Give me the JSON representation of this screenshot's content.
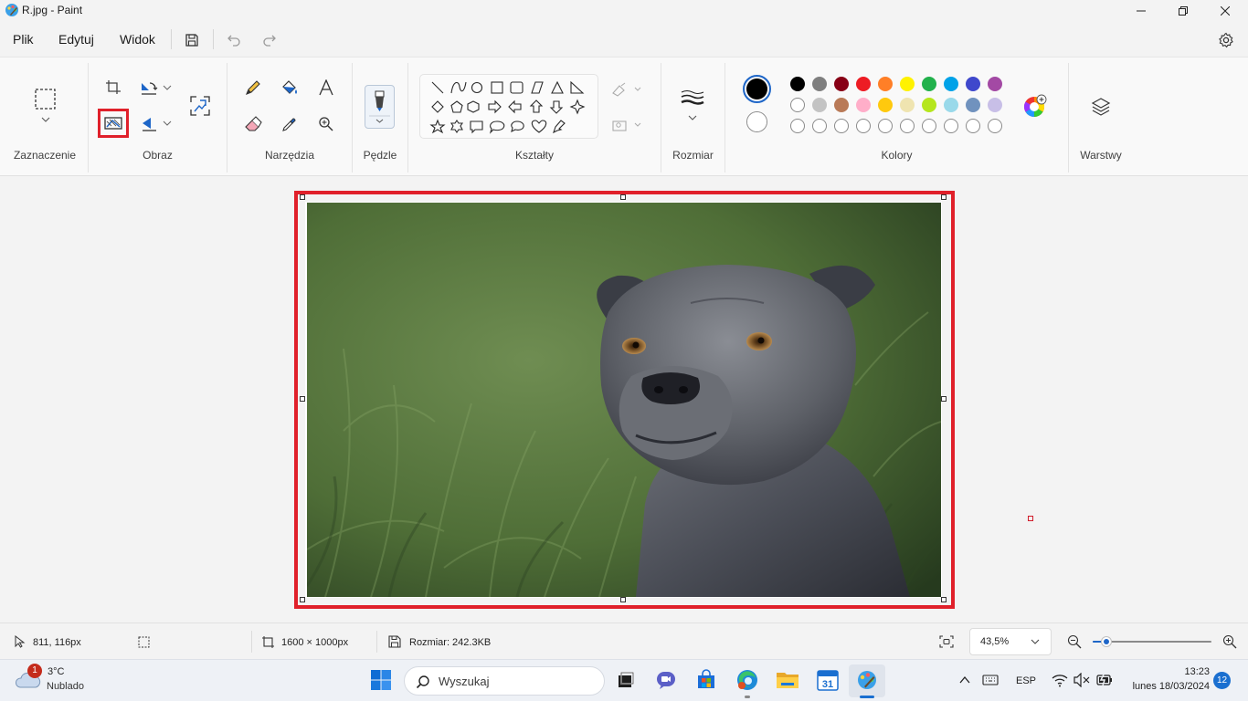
{
  "window": {
    "title": "R.jpg - Paint",
    "icon": "paint-palette-icon"
  },
  "menu": {
    "items": [
      "Plik",
      "Edytuj",
      "Widok"
    ]
  },
  "ribbon": {
    "groups": {
      "selection": "Zaznaczenie",
      "image": "Obraz",
      "tools": "Narzędzia",
      "brushes": "Pędzle",
      "shapes": "Kształty",
      "size": "Rozmiar",
      "colors": "Kolory",
      "layers": "Warstwy"
    },
    "colors": {
      "primary": "#000000",
      "secondary": "#ffffff",
      "palette_row1": [
        "#000000",
        "#7f7f7f",
        "#880015",
        "#ed1c24",
        "#ff7f27",
        "#fff200",
        "#22b14c",
        "#00a2e8",
        "#3f48cc",
        "#a349a4"
      ],
      "palette_row2": [
        "#ffffff",
        "#c3c3c3",
        "#b97a57",
        "#ffaec9",
        "#ffc90e",
        "#efe4b0",
        "#b5e61d",
        "#99d9ea",
        "#7092be",
        "#c8bfe7"
      ]
    }
  },
  "status": {
    "cursor_position": "811, 116px",
    "canvas_size": "1600 × 1000px",
    "file_size": "Rozmiar: 242.3KB",
    "zoom": "43,5%",
    "zoom_slider_fraction": 0.08
  },
  "taskbar": {
    "weather_temp": "3°C",
    "weather_desc": "Nublado",
    "weather_badge": "1",
    "search_placeholder": "Wyszukaj",
    "language": "ESP",
    "time": "13:23",
    "date": "lunes 18/03/2024",
    "notification_count": "12",
    "calendar_day": "31"
  }
}
